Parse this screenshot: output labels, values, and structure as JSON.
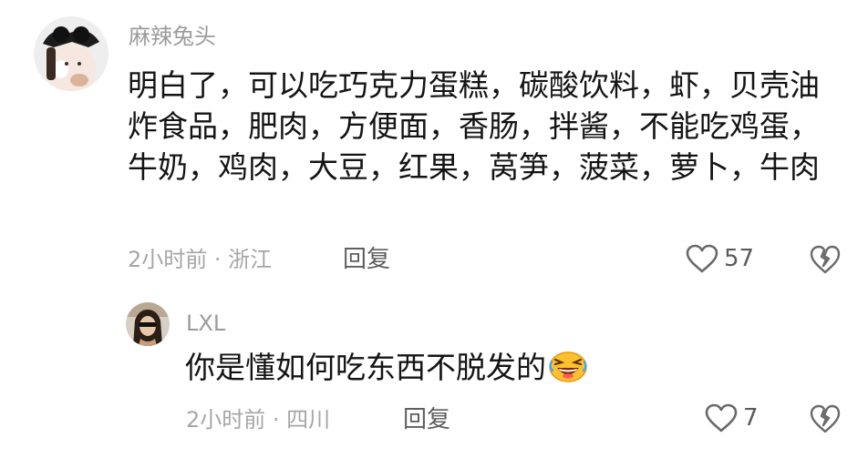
{
  "comments": [
    {
      "username": "麻辣兔头",
      "text": "明白了，可以吃巧克力蛋糕，碳酸饮料，虾，贝壳油炸食品，肥肉，方便面，香肠，拌酱，不能吃鸡蛋，牛奶，鸡肉，大豆，红果，莴笋，菠菜，萝卜，牛肉",
      "meta": "2小时前 · 浙江",
      "reply_label": "回复",
      "likes": "57"
    },
    {
      "username": "LXL",
      "text": "你是懂如何吃东西不脱发的",
      "meta": "2小时前 · 四川",
      "reply_label": "回复",
      "likes": "7",
      "emoji": "laughing-face"
    }
  ]
}
